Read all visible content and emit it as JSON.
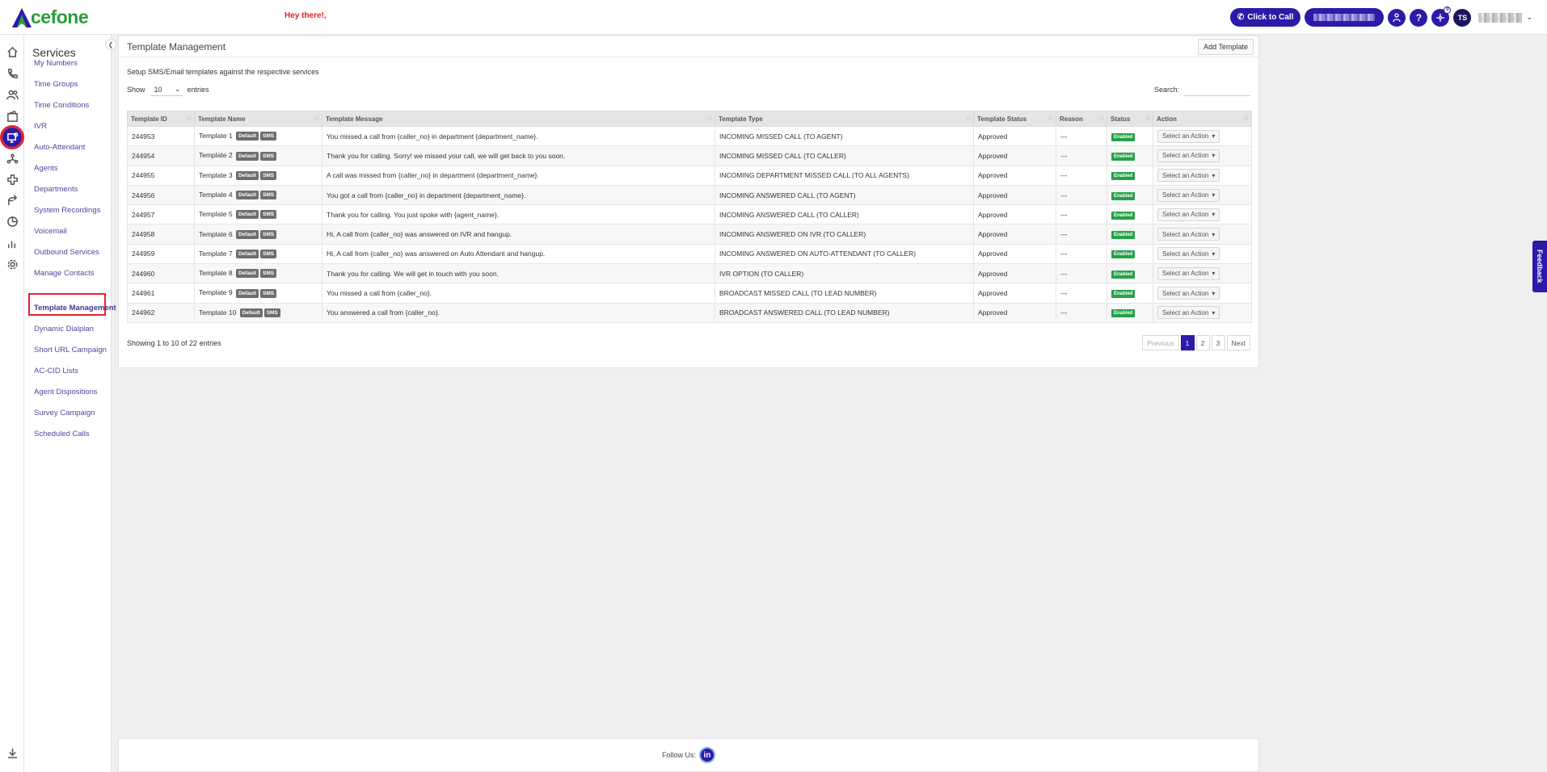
{
  "app": {
    "logo_text": "cefone",
    "greeting": "Hey there!,"
  },
  "header": {
    "click_to_call_label": "Click to Call",
    "user_initials": "TS",
    "notification_count": "0",
    "help_label": "?"
  },
  "sidebar_icons": [
    "home-icon",
    "phone-icon",
    "users-icon",
    "wallet-icon",
    "services-icon",
    "network-icon",
    "integrations-icon",
    "routing-icon",
    "reports-pie-icon",
    "analytics-bar-icon",
    "settings-icon",
    "download-icon"
  ],
  "services": {
    "title": "Services",
    "items": [
      {
        "label": "My Numbers"
      },
      {
        "label": "Time Groups"
      },
      {
        "label": "Time Conditions"
      },
      {
        "label": "IVR"
      },
      {
        "label": "Auto-Attendant"
      },
      {
        "label": "Agents"
      },
      {
        "label": "Departments"
      },
      {
        "label": "System Recordings"
      },
      {
        "label": "Voicemail"
      },
      {
        "label": "Outbound Services"
      },
      {
        "label": "Manage Contacts"
      },
      {
        "label": "Template Management"
      },
      {
        "label": "Dynamic Dialplan"
      },
      {
        "label": "Short URL Campaign"
      },
      {
        "label": "AC-CID Lists"
      },
      {
        "label": "Agent Dispositions"
      },
      {
        "label": "Survey Campaign"
      },
      {
        "label": "Scheduled Calls"
      }
    ],
    "active": "Template Management"
  },
  "main": {
    "title": "Template Management",
    "add_button": "Add Template",
    "description": "Setup SMS/Email templates against the respective services",
    "show_label": "Show",
    "entries_value": "10",
    "entries_label": "entries",
    "search_label": "Search:",
    "search_value": "",
    "columns": [
      "Template ID",
      "Template Name",
      "Template Message",
      "Template Type",
      "Template Status",
      "Reason",
      "Status",
      "Action"
    ],
    "rows": [
      {
        "id": "244953",
        "name": "Template 1",
        "tag1": "Default",
        "tag2": "SMS",
        "message": "You missed a call from {caller_no} in department {department_name}.",
        "type": "INCOMING MISSED CALL (TO AGENT)",
        "tstatus": "Approved",
        "reason": "---",
        "status": "Enabled",
        "action": "Select an Action"
      },
      {
        "id": "244954",
        "name": "Template 2",
        "tag1": "Default",
        "tag2": "SMS",
        "message": "Thank you for calling. Sorry! we missed your call, we will get back to you soon.",
        "type": "INCOMING MISSED CALL (TO CALLER)",
        "tstatus": "Approved",
        "reason": "---",
        "status": "Enabled",
        "action": "Select an Action"
      },
      {
        "id": "244955",
        "name": "Template 3",
        "tag1": "Default",
        "tag2": "SMS",
        "message": "A call was missed from {caller_no} in department {department_name}.",
        "type": "INCOMING DEPARTMENT MISSED CALL (TO ALL AGENTS)",
        "tstatus": "Approved",
        "reason": "---",
        "status": "Enabled",
        "action": "Select an Action"
      },
      {
        "id": "244956",
        "name": "Template 4",
        "tag1": "Default",
        "tag2": "SMS",
        "message": "You got a call from {caller_no} in department {department_name}.",
        "type": "INCOMING ANSWERED CALL (TO AGENT)",
        "tstatus": "Approved",
        "reason": "---",
        "status": "Enabled",
        "action": "Select an Action"
      },
      {
        "id": "244957",
        "name": "Template 5",
        "tag1": "Default",
        "tag2": "SMS",
        "message": "Thank you for calling. You just spoke with {agent_name}.",
        "type": "INCOMING ANSWERED CALL (TO CALLER)",
        "tstatus": "Approved",
        "reason": "---",
        "status": "Enabled",
        "action": "Select an Action"
      },
      {
        "id": "244958",
        "name": "Template 6",
        "tag1": "Default",
        "tag2": "SMS",
        "message": "Hi, A call from {caller_no} was answered on IVR and hangup.",
        "type": "INCOMING ANSWERED ON IVR (TO CALLER)",
        "tstatus": "Approved",
        "reason": "---",
        "status": "Enabled",
        "action": "Select an Action"
      },
      {
        "id": "244959",
        "name": "Template 7",
        "tag1": "Default",
        "tag2": "SMS",
        "message": "Hi, A call from {caller_no} was answered on Auto Attendant and hangup.",
        "type": "INCOMING ANSWERED ON AUTO-ATTENDANT (TO CALLER)",
        "tstatus": "Approved",
        "reason": "---",
        "status": "Enabled",
        "action": "Select an Action"
      },
      {
        "id": "244960",
        "name": "Template 8",
        "tag1": "Default",
        "tag2": "SMS",
        "message": "Thank you for calling. We will get in touch with you soon.",
        "type": "IVR OPTION (TO CALLER)",
        "tstatus": "Approved",
        "reason": "---",
        "status": "Enabled",
        "action": "Select an Action"
      },
      {
        "id": "244961",
        "name": "Template 9",
        "tag1": "Default",
        "tag2": "SMS",
        "message": "You missed a call from {caller_no}.",
        "type": "BROADCAST MISSED CALL (TO LEAD NUMBER)",
        "tstatus": "Approved",
        "reason": "---",
        "status": "Enabled",
        "action": "Select an Action"
      },
      {
        "id": "244962",
        "name": "Template 10",
        "tag1": "Default",
        "tag2": "SMS",
        "message": "You answered a call from {caller_no}.",
        "type": "BROADCAST ANSWERED CALL (TO LEAD NUMBER)",
        "tstatus": "Approved",
        "reason": "---",
        "status": "Enabled",
        "action": "Select an Action"
      }
    ],
    "showing_text": "Showing 1 to 10 of 22 entries",
    "pagination": {
      "previous": "Previous",
      "pages": [
        "1",
        "2",
        "3"
      ],
      "current": "1",
      "next": "Next"
    }
  },
  "footer": {
    "follow_label": "Follow Us:",
    "linkedin_label": "in"
  },
  "feedback_label": "Feedback",
  "colors": {
    "brand": "#2c1aa8",
    "enabled": "#24a247",
    "highlight": "#e8232a",
    "logo_green": "#2a9d3a"
  }
}
